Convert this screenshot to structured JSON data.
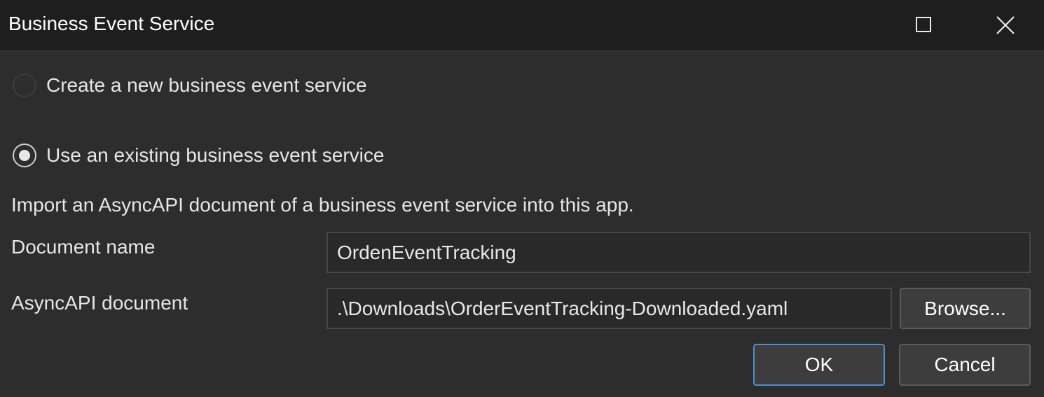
{
  "window": {
    "title": "Business Event Service",
    "maximize_icon": "maximize-icon",
    "close_icon": "close-icon"
  },
  "options": {
    "create_new_label": "Create a new business event service",
    "create_new_selected": false,
    "use_existing_label": "Use an existing business event service",
    "use_existing_selected": true
  },
  "description": "Import an AsyncAPI document of a business event service into this app.",
  "fields": {
    "document_name_label": "Document name",
    "document_name_value": "OrdenEventTracking",
    "asyncapi_label": "AsyncAPI document",
    "asyncapi_value": ".\\Downloads\\OrderEventTracking-Downloaded.yaml"
  },
  "buttons": {
    "browse_label": "Browse...",
    "ok_label": "OK",
    "cancel_label": "Cancel"
  },
  "colors": {
    "titlebar_bg": "#1e1e1e",
    "dialog_bg": "#2d2d2d",
    "primary_border": "#4d8fd1"
  }
}
